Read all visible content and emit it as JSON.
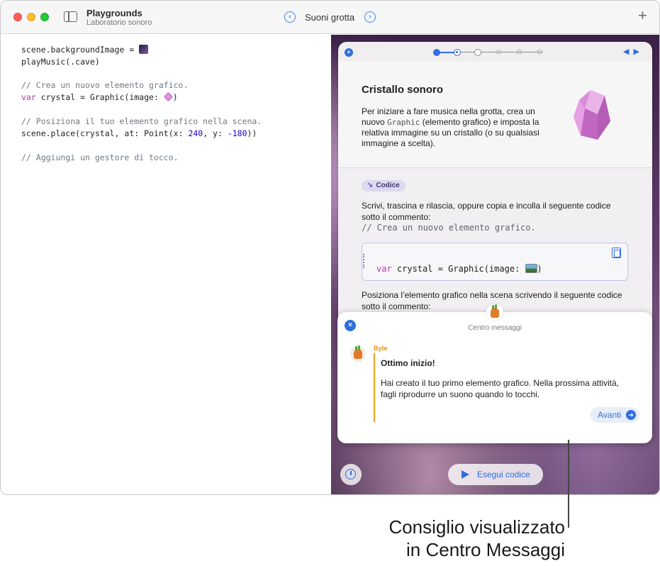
{
  "titlebar": {
    "app_title": "Playgrounds",
    "app_subtitle": "Laboratorio sonoro",
    "page_title": "Suoni grotta",
    "prev_icon": "chevron-left-icon",
    "next_icon": "chevron-right-icon",
    "add_icon": "plus-icon"
  },
  "editor": {
    "lines": [
      {
        "text": "scene.backgroundImage = ",
        "token": "cave-image"
      },
      {
        "text": "playMusic(.cave)"
      },
      {
        "comment": "// Crea un nuovo elemento grafico."
      },
      {
        "kw": "var",
        "text": " crystal = Graphic(image: ",
        "token": "crystal-image",
        "after": ")"
      },
      {
        "comment": "// Posiziona il tuo elemento grafico nella scena."
      },
      {
        "text": "scene.place(crystal, at: Point(x: ",
        "x": "240",
        "mid": ", y: ",
        "y": "-180",
        "end": "))"
      },
      {
        "comment": "// Aggiungi un gestore di tocco."
      }
    ]
  },
  "guide": {
    "steps": {
      "total": 6,
      "completed": 1,
      "current": 2
    },
    "heading": "Cristallo sonoro",
    "intro_a": "Per iniziare a fare musica nella grotta, crea un nuovo ",
    "intro_mono": "Graphic",
    "intro_b": " (elemento grafico) e imposta la relativa immagine su un cristallo (o su qualsiasi immagine a scelta).",
    "badge": "Codice",
    "instruction_1": "Scrivi, trascina e rilascia, oppure copia e incolla il seguente codice sotto il commento:",
    "comment": "// Crea un nuovo elemento grafico.",
    "snippet_kw": "var",
    "snippet_code": " crystal = Graphic(image: ",
    "snippet_end": ")",
    "instruction_2": "Posiziona l’elemento grafico nella scena scrivendo il seguente codice sotto il commento:"
  },
  "messages": {
    "title": "Centro messaggi",
    "sender": "Byte",
    "heading": "Ottimo inizio!",
    "body": "Hai creato il tuo primo elemento grafico. Nella prossima attività, fagli riprodurre un suono quando lo tocchi.",
    "next_label": "Avanti"
  },
  "bottom": {
    "run_label": "Esegui codice"
  },
  "callout": {
    "line1": "Consiglio visualizzato",
    "line2": "in Centro Messaggi"
  }
}
